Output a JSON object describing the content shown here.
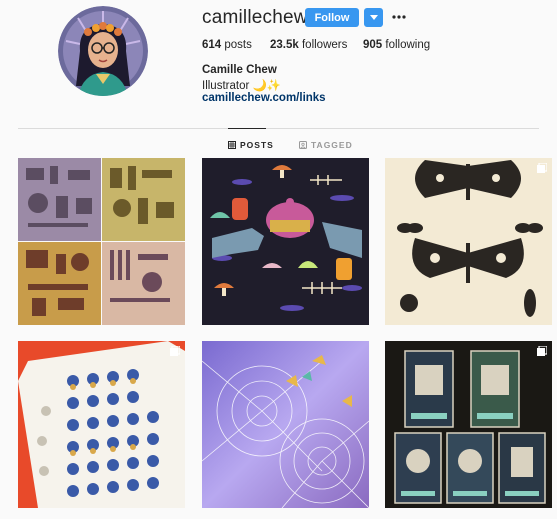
{
  "profile": {
    "username": "camillechew",
    "full_name": "Camille Chew",
    "bio": "Illustrator 🌙✨",
    "link": "camillechew.com/links",
    "follow_label": "Follow"
  },
  "stats": {
    "posts_count": "614",
    "posts_label": "posts",
    "followers_count": "23.5k",
    "followers_label": "followers",
    "following_count": "905",
    "following_label": "following"
  },
  "tabs": {
    "posts": "POSTS",
    "tagged": "TAGGED"
  },
  "icons": {
    "dropdown": "chevron-down-icon",
    "more": "more-icon",
    "posts_tab": "grid-icon",
    "tagged_tab": "tag-icon",
    "multi": "multiple-photos-icon"
  },
  "colors": {
    "follow_button": "#3897f0",
    "link": "#003569"
  }
}
